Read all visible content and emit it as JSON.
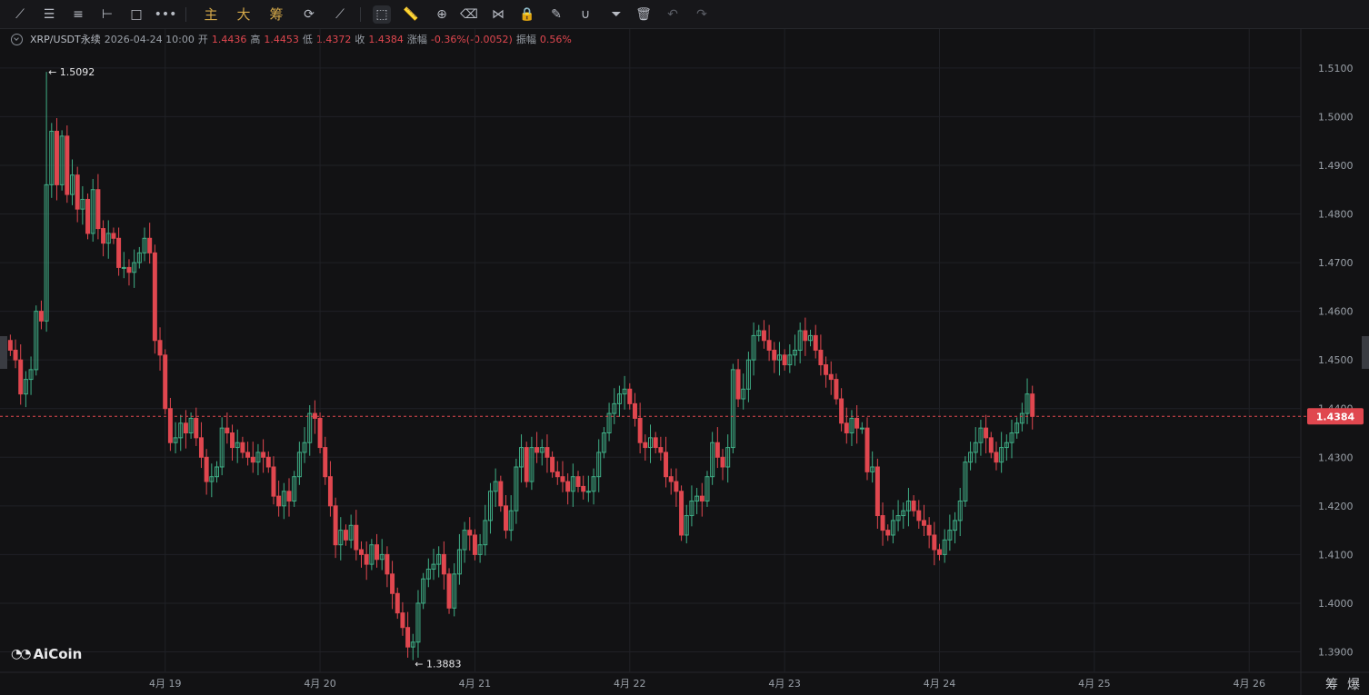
{
  "toolbar": {
    "tools": [
      "line-tool-icon",
      "horizontal-lines-icon",
      "parallel-lines-icon",
      "horizontal-ray-icon",
      "rectangle-icon",
      "more-tools-icon"
    ],
    "main_label": "主",
    "big_label": "大",
    "chip_label": "筹",
    "right_tools": [
      "sync-icon",
      "auto-draw-icon",
      "select-icon",
      "ruler-icon",
      "zoom-icon",
      "eraser-icon",
      "pattern-icon",
      "lock-icon",
      "notes-icon",
      "magnet-icon",
      "filter-icon",
      "trash-icon",
      "undo-icon",
      "redo-icon"
    ]
  },
  "info": {
    "symbol": "XRP/USDT永续",
    "datetime": "2026-04-24 10:00",
    "open_label": "开",
    "open": "1.4436",
    "high_label": "高",
    "high": "1.4453",
    "low_label": "低",
    "low": "1.4372",
    "close_label": "收",
    "close": "1.4384",
    "change_label": "涨幅",
    "change": "-0.36%(-0.0052)",
    "amp_label": "振幅",
    "amp": "0.56%"
  },
  "logo": "AiCoin",
  "corner": {
    "left": "筹",
    "right": "爆"
  },
  "colors": {
    "up": "#3fae86",
    "down": "#e0474f",
    "bg": "#121214",
    "grid": "#202126"
  },
  "chart_data": {
    "type": "candlestick",
    "timeframe": "1h",
    "y_ticks": [
      "1.3900",
      "1.4000",
      "1.4100",
      "1.4200",
      "1.4300",
      "1.4400",
      "1.4500",
      "1.4600",
      "1.4700",
      "1.4800",
      "1.4900",
      "1.5000",
      "1.5100"
    ],
    "ylim": [
      1.3858,
      1.518
    ],
    "x_ticks": [
      "4月 19",
      "4月 20",
      "4月 21",
      "4月 22",
      "4月 23",
      "4月 24",
      "4月 25",
      "4月 26"
    ],
    "x_tick_index": [
      30,
      60,
      90,
      120,
      150,
      180,
      210,
      240
    ],
    "xlim": [
      -2,
      250
    ],
    "last_price": "1.4384",
    "max_label": "1.5092",
    "min_label": "1.3883",
    "max_index": 7,
    "min_index": 78,
    "closes": [
      1.452,
      1.45,
      1.443,
      1.446,
      1.448,
      1.46,
      1.458,
      1.486,
      1.497,
      1.486,
      1.496,
      1.484,
      1.488,
      1.481,
      1.483,
      1.476,
      1.485,
      1.477,
      1.474,
      1.476,
      1.475,
      1.469,
      1.469,
      1.468,
      1.47,
      1.472,
      1.475,
      1.472,
      1.454,
      1.451,
      1.44,
      1.433,
      1.434,
      1.437,
      1.435,
      1.438,
      1.434,
      1.43,
      1.425,
      1.426,
      1.428,
      1.436,
      1.435,
      1.432,
      1.433,
      1.431,
      1.43,
      1.429,
      1.431,
      1.43,
      1.428,
      1.422,
      1.42,
      1.423,
      1.421,
      1.426,
      1.431,
      1.433,
      1.439,
      1.438,
      1.432,
      1.426,
      1.42,
      1.412,
      1.415,
      1.413,
      1.416,
      1.411,
      1.41,
      1.408,
      1.412,
      1.409,
      1.41,
      1.406,
      1.402,
      1.398,
      1.395,
      1.391,
      1.392,
      1.4,
      1.405,
      1.407,
      1.408,
      1.41,
      1.406,
      1.399,
      1.406,
      1.411,
      1.415,
      1.414,
      1.41,
      1.412,
      1.417,
      1.423,
      1.425,
      1.42,
      1.415,
      1.419,
      1.428,
      1.432,
      1.425,
      1.432,
      1.431,
      1.432,
      1.43,
      1.427,
      1.426,
      1.425,
      1.423,
      1.426,
      1.424,
      1.423,
      1.423,
      1.426,
      1.431,
      1.435,
      1.439,
      1.441,
      1.443,
      1.444,
      1.441,
      1.438,
      1.433,
      1.432,
      1.434,
      1.432,
      1.431,
      1.426,
      1.425,
      1.423,
      1.414,
      1.418,
      1.421,
      1.422,
      1.421,
      1.426,
      1.433,
      1.43,
      1.428,
      1.432,
      1.448,
      1.442,
      1.444,
      1.45,
      1.455,
      1.456,
      1.454,
      1.452,
      1.45,
      1.451,
      1.449,
      1.451,
      1.452,
      1.456,
      1.454,
      1.455,
      1.452,
      1.449,
      1.447,
      1.446,
      1.442,
      1.437,
      1.435,
      1.438,
      1.436,
      1.436,
      1.427,
      1.428,
      1.418,
      1.415,
      1.414,
      1.417,
      1.418,
      1.419,
      1.421,
      1.419,
      1.417,
      1.416,
      1.414,
      1.411,
      1.41,
      1.413,
      1.415,
      1.417,
      1.421,
      1.429,
      1.431,
      1.433,
      1.436,
      1.434,
      1.431,
      1.429,
      1.432,
      1.433,
      1.435,
      1.437,
      1.439,
      1.443,
      1.4384
    ]
  }
}
